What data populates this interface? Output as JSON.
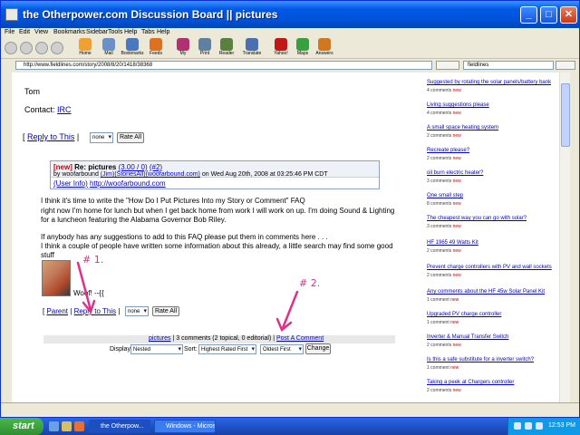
{
  "window": {
    "title": "the Otherpower.com Discussion Board || pictures",
    "controls": {
      "minimize": "_",
      "maximize": "□",
      "close": "✕"
    }
  },
  "menu": [
    "File",
    "Edit",
    "View",
    "Bookmarks",
    "Sidebar",
    "Tools",
    "Help",
    "Tabs",
    "Help"
  ],
  "toolbar": {
    "buttons": [
      {
        "label": "Home",
        "color": "#f0a030"
      },
      {
        "label": "Mail",
        "color": "#6a90c8"
      },
      {
        "label": "Bookmarks",
        "color": "#4a78c0"
      },
      {
        "label": "Feeds",
        "color": "#e07020"
      },
      {
        "label": "My",
        "color": "#b03070"
      },
      {
        "label": "Print",
        "color": "#6080a0"
      },
      {
        "label": "Reader",
        "color": "#5a8040"
      },
      {
        "label": "Translate",
        "color": "#4a70b0"
      },
      {
        "label": "Yahoo!",
        "color": "#c01818"
      },
      {
        "label": "Maps",
        "color": "#38a040"
      },
      {
        "label": "Answers",
        "color": "#d07820"
      }
    ]
  },
  "address": {
    "label": "",
    "url": "http://www.fieldlines.com/story/2008/8/20/1418/38368",
    "go": "",
    "search_value": "fieldlines"
  },
  "main": {
    "signature_name": "Tom",
    "contact_label": "Contact:",
    "contact_link": "IRC",
    "reply_link": "Reply to This",
    "rate_select": "none",
    "rate_button": "Rate All",
    "comment": {
      "new_label": "[new]",
      "title": "Re: pictures",
      "score": "(3.00 / 0)",
      "delta": "(#2)",
      "by_prefix": "by",
      "author": "woofarbound",
      "author_links": "(Jim)(StoriesAll)(woofarbound.com)",
      "date": "on Wed Aug 20th, 2008 at 03:25:46 PM CDT",
      "user_info_label": "(User Info)",
      "user_url": "http://woofarbound.com"
    },
    "body": [
      "I think it's time to write the \"How Do I Put Pictures Into my Story or Comment\" FAQ",
      "right now I'm home for lunch but when I get back home from work I will work on up. I'm doing Sound & Lighting",
      "for a luncheon featuring the Alabama Governor Bob Riley.",
      "",
      "If anybody has any suggestions to add to this FAQ please put them in comments here . . .",
      "I think a couple of people have written some information about this already, a little search may find some good",
      "stuff"
    ],
    "sig": "Woof! --{{",
    "parent_link": "Parent",
    "reply_link2": "Reply to This",
    "rate_select2": "none",
    "rate_button2": "Rate All",
    "footer": {
      "pictures_link": "pictures",
      "comments_text": "| 3 comments (2 topical, 0 editorial) |",
      "post_link": "Post A Comment"
    },
    "display": {
      "label": "Display:",
      "mode": "Nested",
      "sort_label": "Sort:",
      "rating": "Highest Rated First",
      "order": "Oldest First",
      "change": "Change"
    }
  },
  "annotations": {
    "first": "# 1.",
    "second": "# 2."
  },
  "sidebar": {
    "new_label": "new",
    "items": [
      {
        "title": "Suggested by rotating the solar panels/battery bank",
        "meta": "4 comments"
      },
      {
        "title": "Living suggestions please",
        "meta": "4 comments"
      },
      {
        "title": "A small space heating system",
        "meta": "2 comments"
      },
      {
        "title": "Recreate please?",
        "meta": "2 comments"
      },
      {
        "title": "oil burn electric heater?",
        "meta": "3 comments"
      },
      {
        "title": "One small step",
        "meta": "8 comments"
      },
      {
        "title": "The cheapest way you can go with solar?",
        "meta": "3 comments"
      },
      {
        "title": "HF 1965 49 Watts Kit",
        "meta": "2 comments"
      },
      {
        "title": "Prevent charge controllers with PV and wall sockets",
        "meta": "2 comments"
      },
      {
        "title": "Any comments about the HF 45w Solar Panel Kit",
        "meta": "1 comment"
      },
      {
        "title": "Upgraded PV charge controller",
        "meta": "1 comment"
      },
      {
        "title": "Inverter & Manual Transfer Switch",
        "meta": "2 comments"
      },
      {
        "title": "Is this a safe substitute for a inverter switch?",
        "meta": "1 comment"
      },
      {
        "title": "Taking a peek at Chargers controller",
        "meta": "2 comments"
      }
    ]
  },
  "taskbar": {
    "start": "start",
    "tasks": [
      "the Otherpow...",
      "Windows - Micros..."
    ],
    "clock": "12:53 PM"
  }
}
